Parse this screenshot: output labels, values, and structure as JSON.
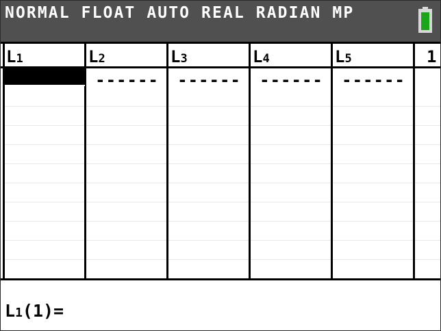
{
  "status_bar": {
    "mode_text": "NORMAL FLOAT AUTO REAL RADIAN MP",
    "battery_icon": "battery-icon",
    "battery_color": "#1aa51a"
  },
  "list_editor": {
    "columns": [
      {
        "name": "L",
        "index": "1"
      },
      {
        "name": "L",
        "index": "2"
      },
      {
        "name": "L",
        "index": "3"
      },
      {
        "name": "L",
        "index": "4"
      },
      {
        "name": "L",
        "index": "5"
      }
    ],
    "partial_column_label": "1",
    "empty_cell": "------",
    "selected_column": 0
  },
  "entry_line": {
    "prefix": "L",
    "index": "1",
    "rest": "(1)="
  }
}
